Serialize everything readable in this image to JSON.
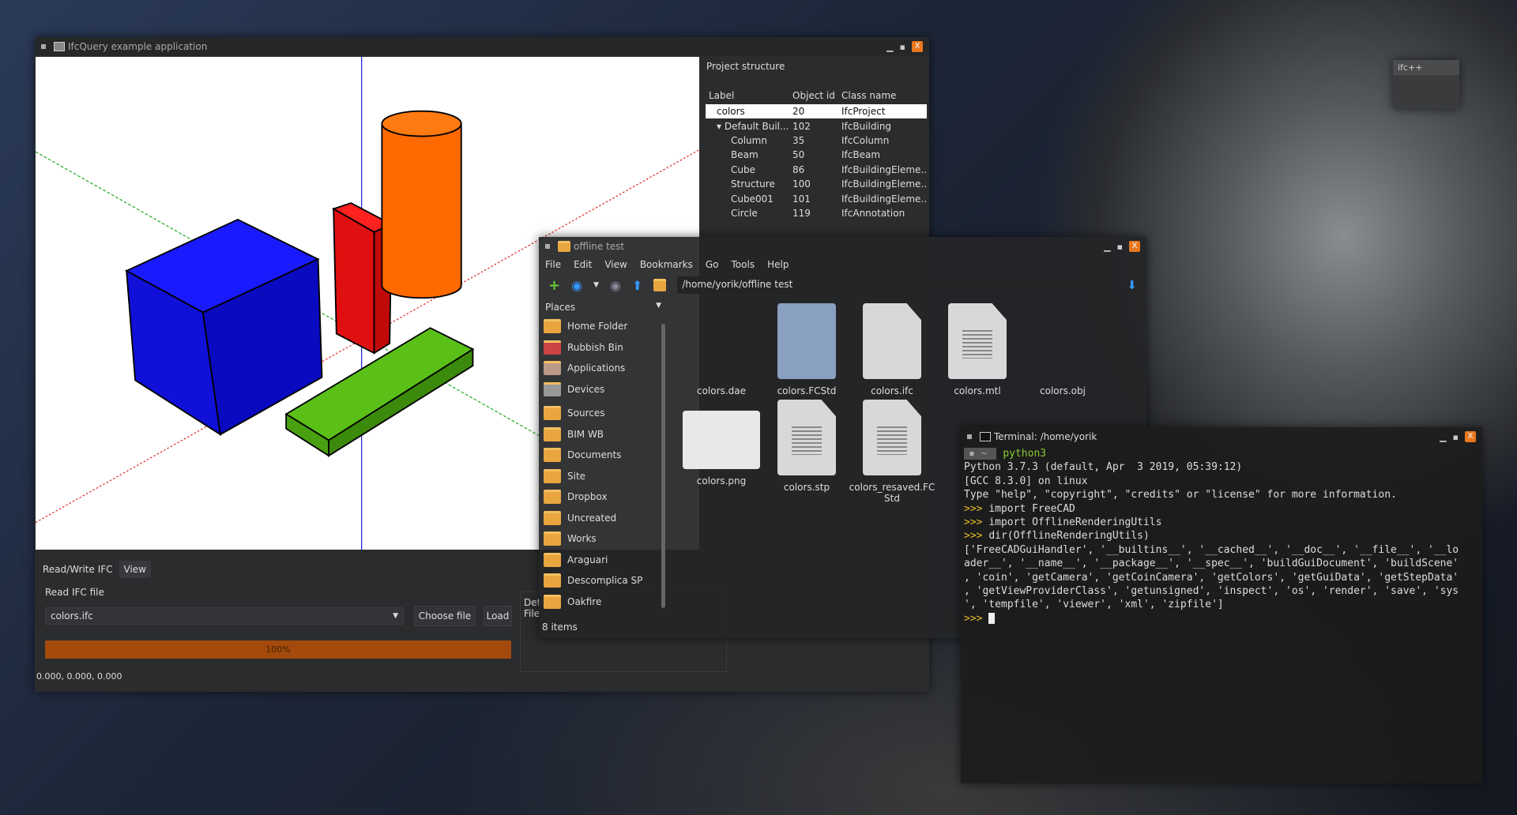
{
  "ifc_window": {
    "title": "IfcQuery example application",
    "panel_title": "Project structure",
    "columns": [
      "Label",
      "Object id",
      "Class name"
    ],
    "rows": [
      {
        "label": "colors",
        "id": "20",
        "cls": "IfcProject"
      },
      {
        "label": "▾ Default Buil...",
        "id": "102",
        "cls": "IfcBuilding"
      },
      {
        "label": "Column",
        "id": "35",
        "cls": "IfcColumn"
      },
      {
        "label": "Beam",
        "id": "50",
        "cls": "IfcBeam"
      },
      {
        "label": "Cube",
        "id": "86",
        "cls": "IfcBuildingEleme..."
      },
      {
        "label": "Structure",
        "id": "100",
        "cls": "IfcBuildingEleme..."
      },
      {
        "label": "Cube001",
        "id": "101",
        "cls": "IfcBuildingEleme..."
      },
      {
        "label": "Circle",
        "id": "119",
        "cls": "IfcAnnotation"
      }
    ],
    "tabs": [
      "Read/Write IFC",
      "View"
    ],
    "read_label": "Read IFC file",
    "file_value": "colors.ifc",
    "choose_label": "Choose file",
    "load_label": "Load",
    "progress": 100,
    "progress_text": "100%",
    "details_label": "Dete",
    "file_label": "File",
    "status": "0.000, 0.000, 0.000",
    "colors": {
      "cube": "#1010e0",
      "column": "#e01010",
      "cylinder": "#ff6a00",
      "beam": "#50b010",
      "progress": "#a34a0c"
    }
  },
  "file_manager": {
    "title": "offline test",
    "menu": [
      "File",
      "Edit",
      "View",
      "Bookmarks",
      "Go",
      "Tools",
      "Help"
    ],
    "path": "/home/yorik/offline test",
    "places_label": "Places",
    "places": [
      "Home Folder",
      "Rubbish Bin",
      "Applications",
      "Devices",
      "Sources",
      "BIM WB",
      "Documents",
      "Site",
      "Dropbox",
      "Uncreated",
      "Works",
      "Araguari",
      "Descomplica SP",
      "Oakfire"
    ],
    "files": [
      "colors.dae",
      "colors.FCStd",
      "colors.ifc",
      "colors.mtl",
      "colors.obj",
      "colors.png",
      "colors.stp",
      "colors_resaved.FCStd"
    ],
    "status": "8 items"
  },
  "terminal": {
    "title": "Terminal: /home/yorik",
    "command": "python3",
    "lines": [
      {
        "p": "",
        "t": "Python 3.7.3 (default, Apr  3 2019, 05:39:12)"
      },
      {
        "p": "",
        "t": "[GCC 8.3.0] on linux"
      },
      {
        "p": "",
        "t": "Type \"help\", \"copyright\", \"credits\" or \"license\" for more information."
      },
      {
        "p": ">>> ",
        "t": "import FreeCAD"
      },
      {
        "p": ">>> ",
        "t": "import OfflineRenderingUtils"
      },
      {
        "p": ">>> ",
        "t": "dir(OfflineRenderingUtils)"
      },
      {
        "p": "",
        "t": "['FreeCADGuiHandler', '__builtins__', '__cached__', '__doc__', '__file__', '__lo"
      },
      {
        "p": "",
        "t": "ader__', '__name__', '__package__', '__spec__', 'buildGuiDocument', 'buildScene'"
      },
      {
        "p": "",
        "t": ", 'coin', 'getCamera', 'getCoinCamera', 'getColors', 'getGuiData', 'getStepData'"
      },
      {
        "p": "",
        "t": ", 'getViewProviderClass', 'getunsigned', 'inspect', 'os', 'render', 'save', 'sys"
      },
      {
        "p": "",
        "t": "', 'tempfile', 'viewer', 'xml', 'zipfile']"
      },
      {
        "p": ">>> ",
        "t": ""
      }
    ]
  },
  "mini_window": {
    "title": "ifc++"
  }
}
